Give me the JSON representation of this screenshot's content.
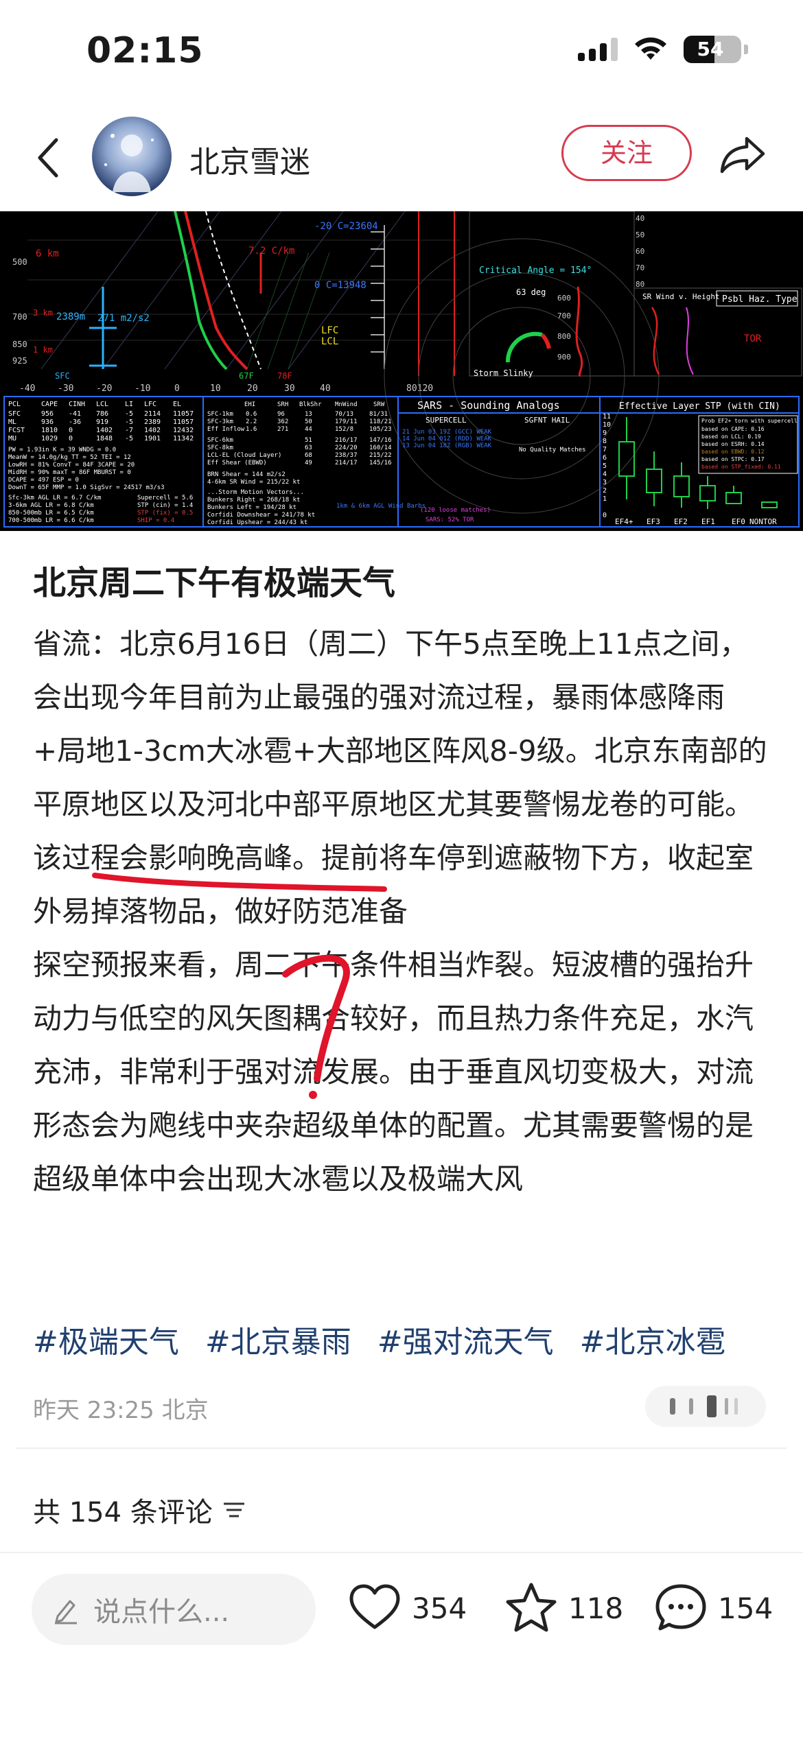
{
  "status_bar": {
    "time": "02:15",
    "battery": "54",
    "battery_fraction": 0.54
  },
  "header": {
    "author": "北京雪迷",
    "follow_label": "关注"
  },
  "weather_image": {
    "altitude_ticks": [
      "500",
      "700",
      "850",
      "925"
    ],
    "lapse_label": "6 km",
    "lapse_rate": "7.2 C/km",
    "freezing_level": "-20 C=23604",
    "zero_level": "0 C=13948",
    "cape": "2389m",
    "area_label": "271 m2/s2",
    "lfc": "LFC",
    "lcl": "LCL",
    "km_labels": [
      "3 km",
      "1 km"
    ],
    "sfc": "SFC",
    "temps": [
      "67F",
      "78F"
    ],
    "x_axis": [
      "-40",
      "-30",
      "-20",
      "-10",
      "0",
      "10",
      "20",
      "30",
      "40",
      "80120"
    ],
    "critical_angle": "Critical Angle = 154°",
    "hodo_deg": "63 deg",
    "storm_slinky": "Storm Slinky",
    "sr_wind": "SR Wind v. Height",
    "right_scale": [
      "40",
      "50",
      "60",
      "70",
      "80"
    ],
    "mid_scale": [
      "600",
      "700",
      "800",
      "900"
    ],
    "psbl": "Psbl Haz. Type",
    "tor": "TOR",
    "sars_title": "SARS - Sounding Analogs",
    "supercell": "SUPERCELL",
    "sgfnt_hail": "SGFNT HAIL",
    "no_matches": "No Quality Matches",
    "sars_rows": [
      "21 Jun 03 19Z (GCC)  WEAK",
      "14 Jun 04 01Z (RDD)  WEAK",
      "13 Jun 04 18Z (RGB)  WEAK"
    ],
    "loose_matches": "(120 loose matches)",
    "sars_tor": "SARS: 52% TOR",
    "stp_title": "Effective Layer STP (with CIN)",
    "stp_box_title": "Prob EF2+ torn with supercell",
    "stp_box_rows": [
      "based on CAPE:  0.16",
      "based on LCL:  0.19",
      "based on ESRH:  0.14",
      "based on EBWD:  0.12",
      "based on STPC:  0.17",
      "based on STP_fixed: 0.11"
    ],
    "stp_axis": [
      "EF4+",
      "EF3",
      "EF2",
      "EF1",
      "EF0",
      "NONTOR"
    ],
    "stp_y": [
      "11",
      "10",
      "9",
      "8",
      "7",
      "6",
      "5",
      "4",
      "3",
      "2",
      "1",
      "0"
    ],
    "table_header": [
      "PCL",
      "CAPE",
      "CINH",
      "LCL",
      "LI",
      "LFC",
      "EL"
    ],
    "table_rows": [
      [
        "SFC",
        "956",
        "-41",
        "786",
        "-5",
        "2114",
        "11057"
      ],
      [
        "ML",
        "936",
        "-36",
        "919",
        "-5",
        "2389",
        "11057"
      ],
      [
        "FCST",
        "1810",
        "0",
        "1402",
        "-7",
        "1402",
        "12432"
      ],
      [
        "MU",
        "1029",
        "0",
        "1848",
        "-5",
        "1901",
        "11342"
      ]
    ],
    "table_misc": [
      "PW = 1.93in   K = 39   WNDG = 0.0",
      "MeanW = 14.0g/kg  TT = 52  TEI = 12",
      "LowRH = 81%  ConvT = 84F  3CAPE = 20",
      "MidRH = 90%  maxT = 86F  MBURST = 0",
      "DCAPE = 497   ESP = 0",
      "DownT = 65F   MMP = 1.0   SigSvr = 24517 m3/s3"
    ],
    "table_lr": [
      "Sfc-3km AGL LR = 6.7 C/km",
      "3-6km AGL LR = 6.8 C/km",
      "850-500mb LR = 6.5 C/km",
      "700-500mb LR = 6.6 C/km"
    ],
    "supercell_row": "Supercell = 5.6",
    "stp_row": "STP (cin) = 1.4",
    "stp_fix_row": "STP (fix) = 0.5",
    "ship_row": "SHIP = 0.4",
    "kin_header": [
      "EHI",
      "SRH",
      "BlkShr",
      "MnWind",
      "SRW"
    ],
    "kin_rows": [
      [
        "SFC-1km",
        "0.6",
        "96",
        "13",
        "70/13",
        "81/31"
      ],
      [
        "SFC-3km",
        "2.2",
        "362",
        "50",
        "179/11",
        "118/21"
      ],
      [
        "Eff Inflow",
        "1.6",
        "271",
        "44",
        "152/8",
        "105/23"
      ],
      [
        "SFC-6km",
        "",
        "",
        "51",
        "216/17",
        "147/16"
      ],
      [
        "SFC-8km",
        "",
        "",
        "63",
        "224/20",
        "160/14"
      ],
      [
        "LCL-EL (Cloud Layer)",
        "",
        "",
        "68",
        "238/37",
        "215/22"
      ],
      [
        "Eff Shear (EBWD)",
        "",
        "",
        "49",
        "214/17",
        "145/16"
      ]
    ],
    "kin_misc": [
      "BRN Shear =  144 m2/s2",
      "4-6km SR Wind =  215/22 kt",
      "...Storm Motion Vectors...",
      "Bunkers Right =  268/18 kt",
      "Bunkers Left =  194/28 kt",
      "Corfidi Downshear =  241/78 kt",
      "Corfidi Upshear =  244/43 kt"
    ],
    "wind_barbs": "1km & 6km AGL Wind Barbs"
  },
  "article": {
    "title": "北京周二下午有极端天气",
    "para1": "省流：北京6月16日（周二）下午5点至晚上11点之间，会出现今年目前为止最强的强对流过程，暴雨体感降雨+局地1-3cm大冰雹+大部地区阵风8-9级。北京东南部的平原地区以及河北中部平原地区尤其要警惕龙卷的可能。该过程会影响晚高峰。提前将车停到遮蔽物下方，收起室外易掉落物品，做好防范准备",
    "para2": "探空预报来看，周二下午条件相当炸裂。短波槽的强抬升动力与低空的风矢图耦合较好，而且热力条件充足，水汽充沛，非常利于强对流发展。由于垂直风切变极大，对流形态会为飑线中夹杂超级单体的配置。尤其需要警惕的是超级单体中会出现大冰雹以及极端大风",
    "tags": [
      "#极端天气",
      "#北京暴雨",
      "#强对流天气",
      "#北京冰雹"
    ],
    "meta": "昨天 23:25 北京"
  },
  "comments": {
    "count_label": "共 154 条评论"
  },
  "bottom_bar": {
    "input_placeholder": "说点什么...",
    "likes": "354",
    "favorites": "118",
    "comments": "154"
  },
  "colors": {
    "follow": "#d63b4f",
    "tag": "#1f3f6e",
    "annotation": "#e0142a"
  }
}
